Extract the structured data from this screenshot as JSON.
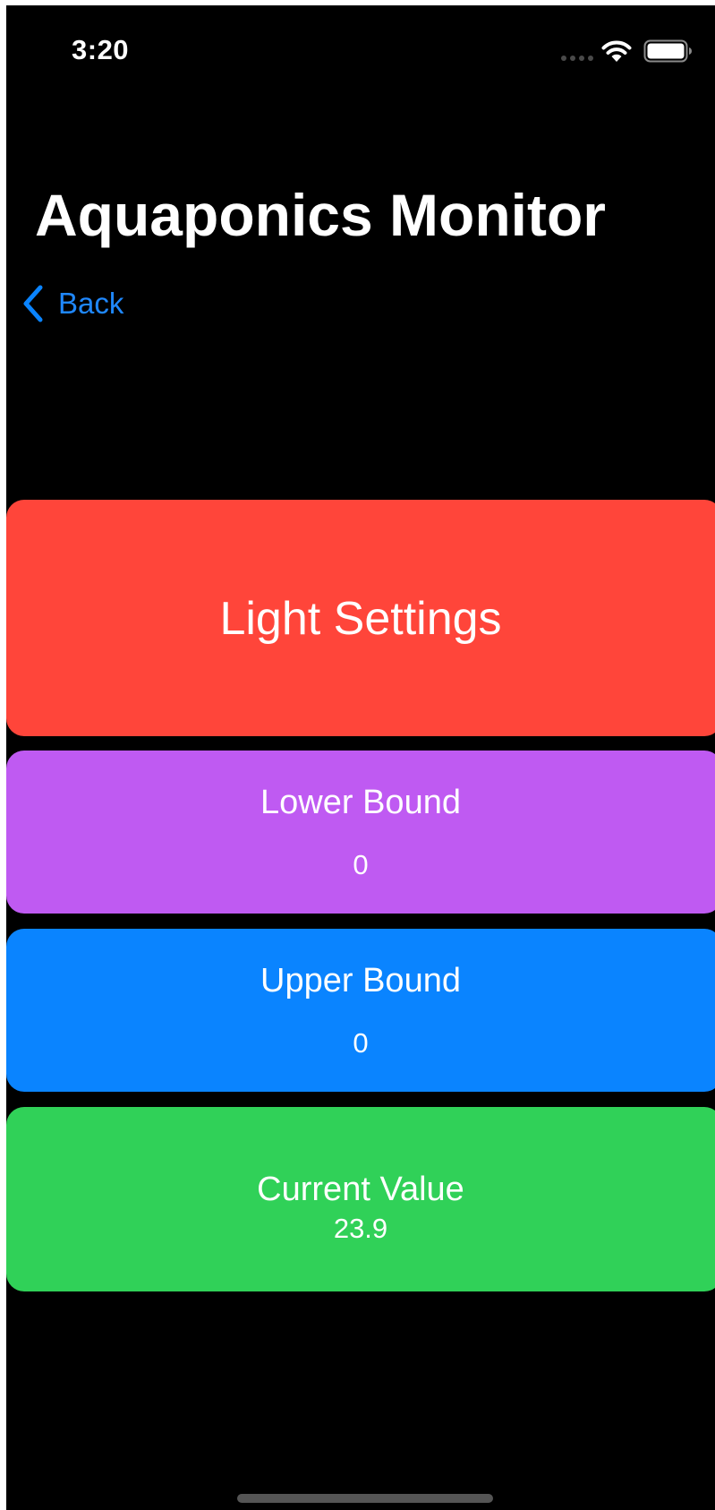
{
  "status_bar": {
    "time": "3:20",
    "icons": [
      "cellular-signal-icon",
      "wifi-icon",
      "battery-icon"
    ]
  },
  "header": {
    "title": "Aquaponics Monitor"
  },
  "navigation": {
    "back_label": "Back",
    "back_icon": "chevron-left-icon",
    "accent_color": "#0a84ff"
  },
  "cards": {
    "light_settings": {
      "title": "Light Settings",
      "color": "#ff453a"
    },
    "lower_bound": {
      "label": "Lower Bound",
      "value": "0",
      "color": "#bf5af2"
    },
    "upper_bound": {
      "label": "Upper Bound",
      "value": "0",
      "color": "#0a84ff"
    },
    "current_value": {
      "label": "Current Value",
      "value": "23.9",
      "color": "#30d158"
    }
  },
  "background_color": "#000000"
}
